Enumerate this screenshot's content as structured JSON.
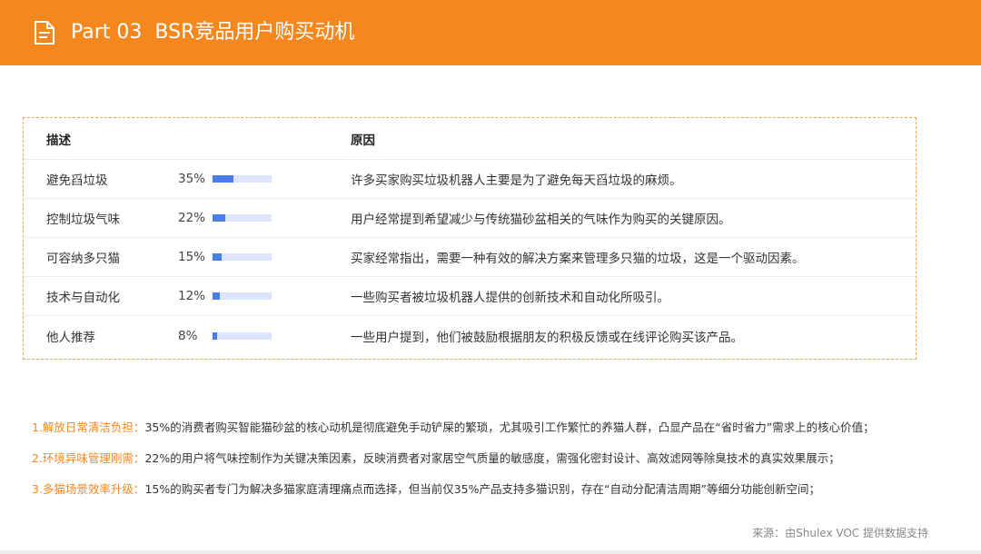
{
  "header": {
    "part": "Part 03",
    "title": "BSR竞品用户购买动机",
    "icon": "document-icon",
    "color": "#f5871f"
  },
  "table": {
    "headers": {
      "desc": "描述",
      "reason": "原因"
    },
    "rows": [
      {
        "desc": "避免舀垃圾",
        "percent_label": "35%",
        "percent": 35,
        "reason": "许多买家购买垃圾机器人主要是为了避免每天舀垃圾的麻烦。"
      },
      {
        "desc": "控制垃圾气味",
        "percent_label": "22%",
        "percent": 22,
        "reason": "用户经常提到希望减少与传统猫砂盆相关的气味作为购买的关键原因。"
      },
      {
        "desc": "可容纳多只猫",
        "percent_label": "15%",
        "percent": 15,
        "reason": "买家经常指出，需要一种有效的解决方案来管理多只猫的垃圾，这是一个驱动因素。"
      },
      {
        "desc": "技术与自动化",
        "percent_label": "12%",
        "percent": 12,
        "reason": "一些购买者被垃圾机器人提供的创新技术和自动化所吸引。"
      },
      {
        "desc": "他人推荐",
        "percent_label": "8%",
        "percent": 8,
        "reason": "一些用户提到，他们被鼓励根据朋友的积极反馈或在线评论购买该产品。"
      }
    ],
    "bar_color": "#4a7de8",
    "bar_track_color": "#dbe5fb"
  },
  "notes": [
    {
      "key": "1.解放日常清洁负担：",
      "text": "35%的消费者购买智能猫砂盆的核心动机是彻底避免手动铲屎的繁琐，尤其吸引工作繁忙的养猫人群，凸显产品在“省时省力”需求上的核心价值；"
    },
    {
      "key": "2.环境异味管理刚需：",
      "text": "22%的用户将气味控制作为关键决策因素，反映消费者对家居空气质量的敏感度，需强化密封设计、高效滤网等除臭技术的真实效果展示；"
    },
    {
      "key": "3.多猫场景效率升级：",
      "text": "15%的购买者专门为解决多猫家庭清理痛点而选择，但当前仅35%产品支持多猫识别，存在“自动分配清洁周期”等细分功能创新空间；"
    }
  ],
  "source": "来源：由Shulex VOC 提供数据支持"
}
